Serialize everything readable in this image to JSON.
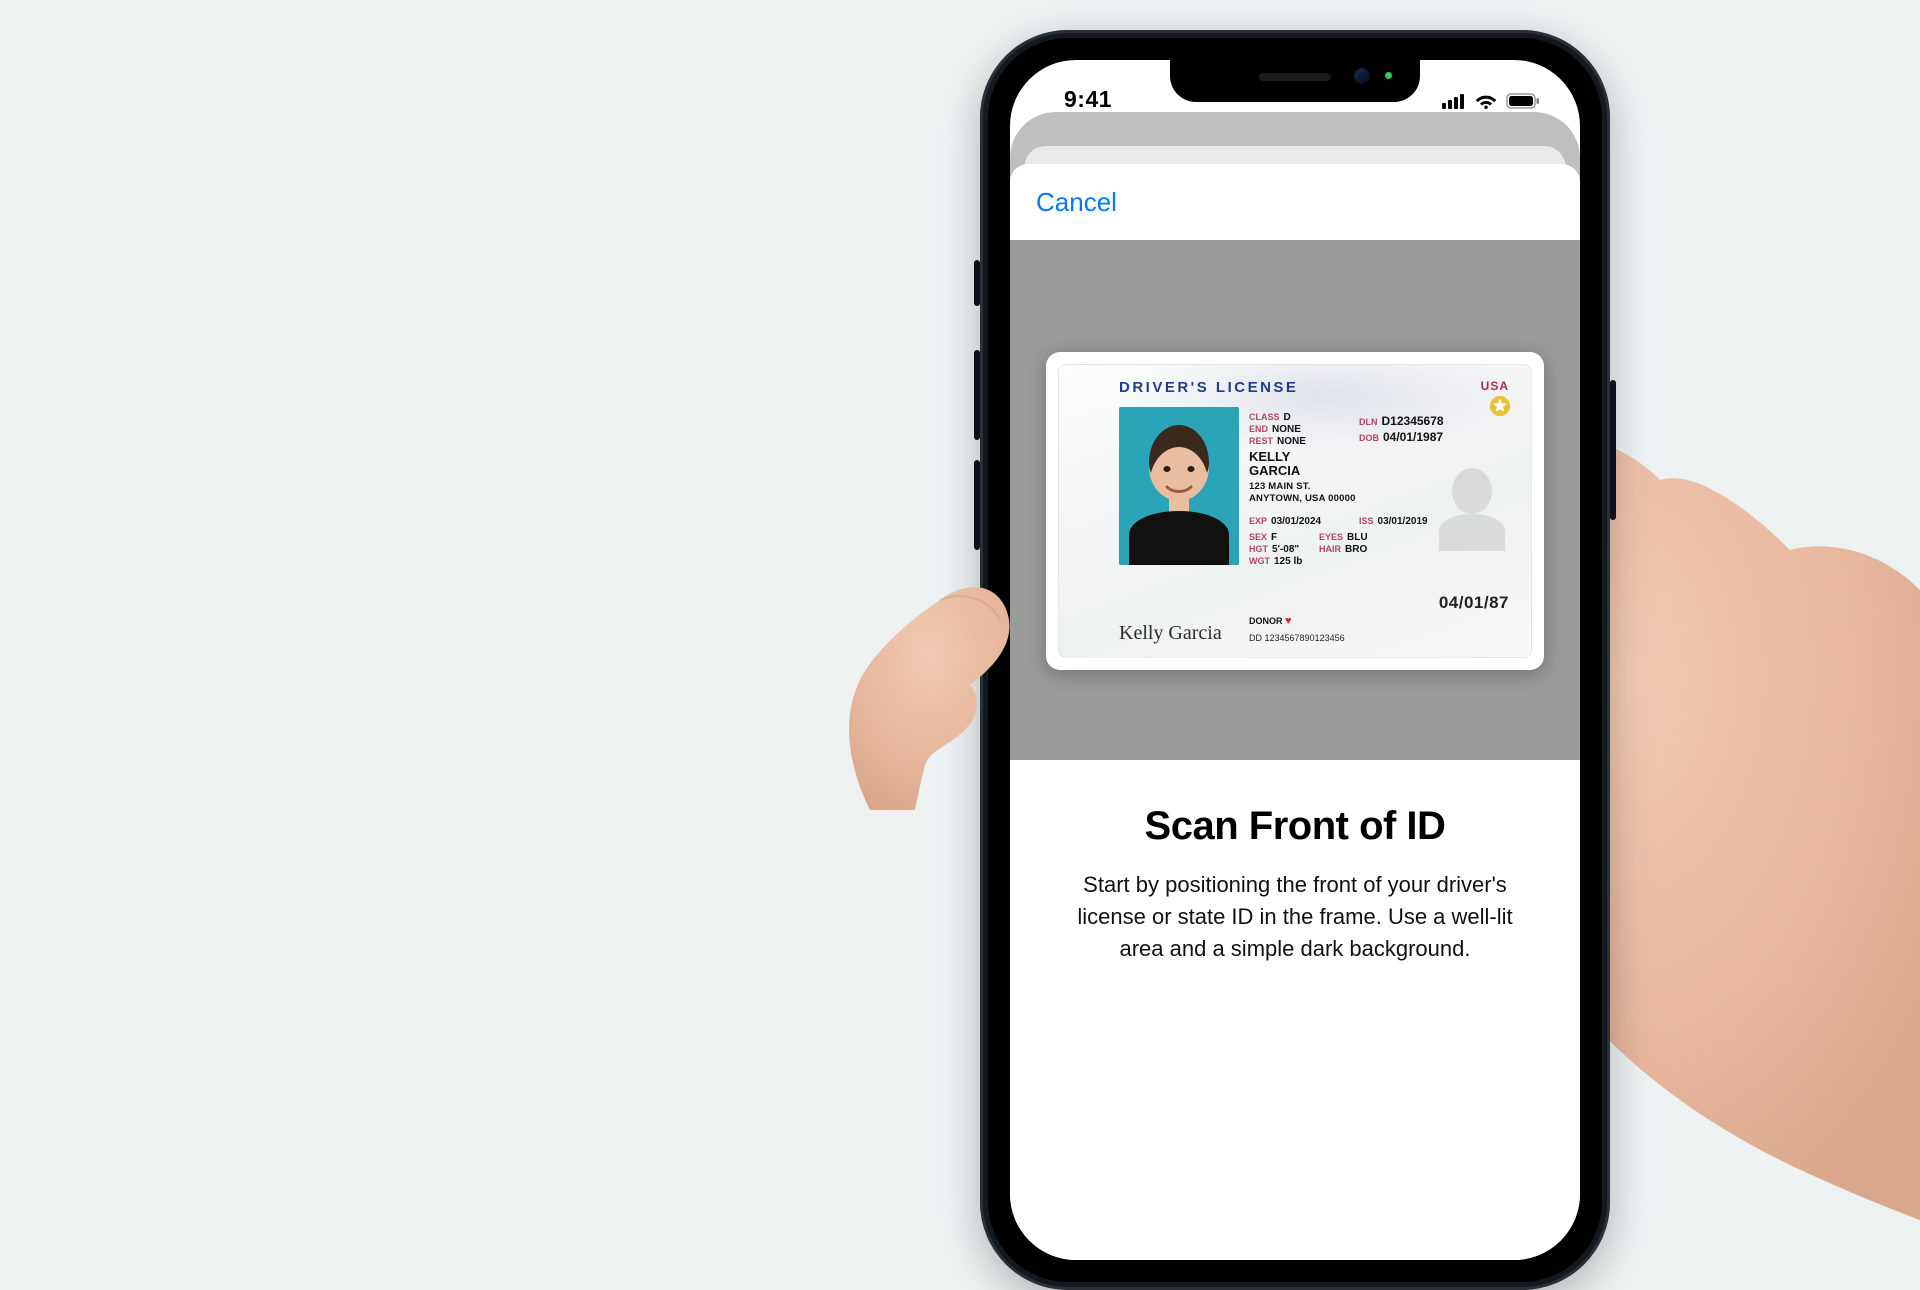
{
  "status": {
    "time": "9:41"
  },
  "sheet": {
    "cancel_label": "Cancel",
    "title": "Scan Front of ID",
    "body": "Start by positioning the front of your driver's license or state ID in the frame. Use a well-lit area and a simple dark background."
  },
  "id_card": {
    "title": "DRIVER'S LICENSE",
    "country": "USA",
    "class_label": "CLASS",
    "class": "D",
    "end_label": "END",
    "end": "NONE",
    "rest_label": "REST",
    "rest": "NONE",
    "dln_label": "DLN",
    "dln": "D12345678",
    "dob_label": "DOB",
    "dob": "04/01/1987",
    "last_name": "KELLY",
    "first_name": "GARCIA",
    "addr1": "123 MAIN ST.",
    "addr2": "ANYTOWN, USA 00000",
    "exp_label": "EXP",
    "exp": "03/01/2024",
    "iss_label": "ISS",
    "iss": "03/01/2019",
    "sex_label": "SEX",
    "sex": "F",
    "eyes_label": "EYES",
    "eyes": "BLU",
    "hgt_label": "HGT",
    "hgt": "5'-08\"",
    "hair_label": "HAIR",
    "hair": "BRO",
    "wgt_label": "WGT",
    "wgt": "125 lb",
    "donor_label": "DONOR",
    "big_date": "04/01/87",
    "dd_label": "DD",
    "dd": "1234567890123456",
    "signature": "Kelly Garcia"
  }
}
